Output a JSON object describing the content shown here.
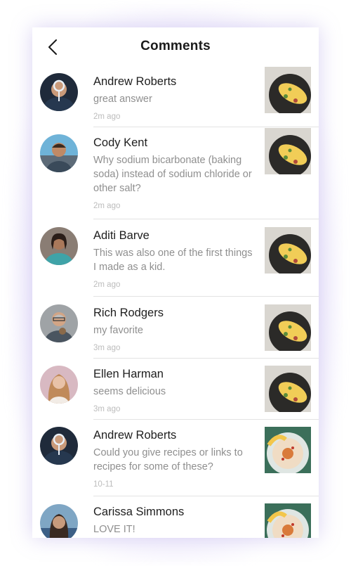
{
  "header": {
    "title": "Comments",
    "back_icon": "chevron-left-icon"
  },
  "comments": [
    {
      "name": "Andrew Roberts",
      "text": "great answer",
      "time": "2m ago",
      "avatar_bg": "#1f2a3a",
      "avatar_skin": "#c99a7a",
      "thumb": "omelette"
    },
    {
      "name": "Cody Kent",
      "text": "Why sodium bicarbonate (baking soda) instead of sodium chloride or other salt?",
      "time": "2m ago",
      "avatar_bg": "#6fb3d8",
      "avatar_skin": "#c08a66",
      "thumb": "omelette"
    },
    {
      "name": "Aditi Barve",
      "text": "This was also one of the first things I made as a kid.",
      "time": "2m ago",
      "avatar_bg": "#8a7d74",
      "avatar_skin": "#a9785a",
      "thumb": "omelette"
    },
    {
      "name": "Rich Rodgers",
      "text": "my favorite",
      "time": "3m ago",
      "avatar_bg": "#9fa3a6",
      "avatar_skin": "#d2a586",
      "thumb": "omelette"
    },
    {
      "name": "Ellen Harman",
      "text": "seems delicious",
      "time": "3m ago",
      "avatar_bg": "#d8b9c2",
      "avatar_skin": "#e8c2a8",
      "thumb": "omelette"
    },
    {
      "name": "Andrew Roberts",
      "text": "Could you give recipes or links to recipes for some of these?",
      "time": "10-11",
      "avatar_bg": "#1f2a3a",
      "avatar_skin": "#c99a7a",
      "thumb": "hummus"
    },
    {
      "name": "Carissa Simmons",
      "text": "LOVE IT!",
      "time": "",
      "avatar_bg": "#7fa6c4",
      "avatar_skin": "#c79b7d",
      "thumb": "hummus"
    }
  ]
}
